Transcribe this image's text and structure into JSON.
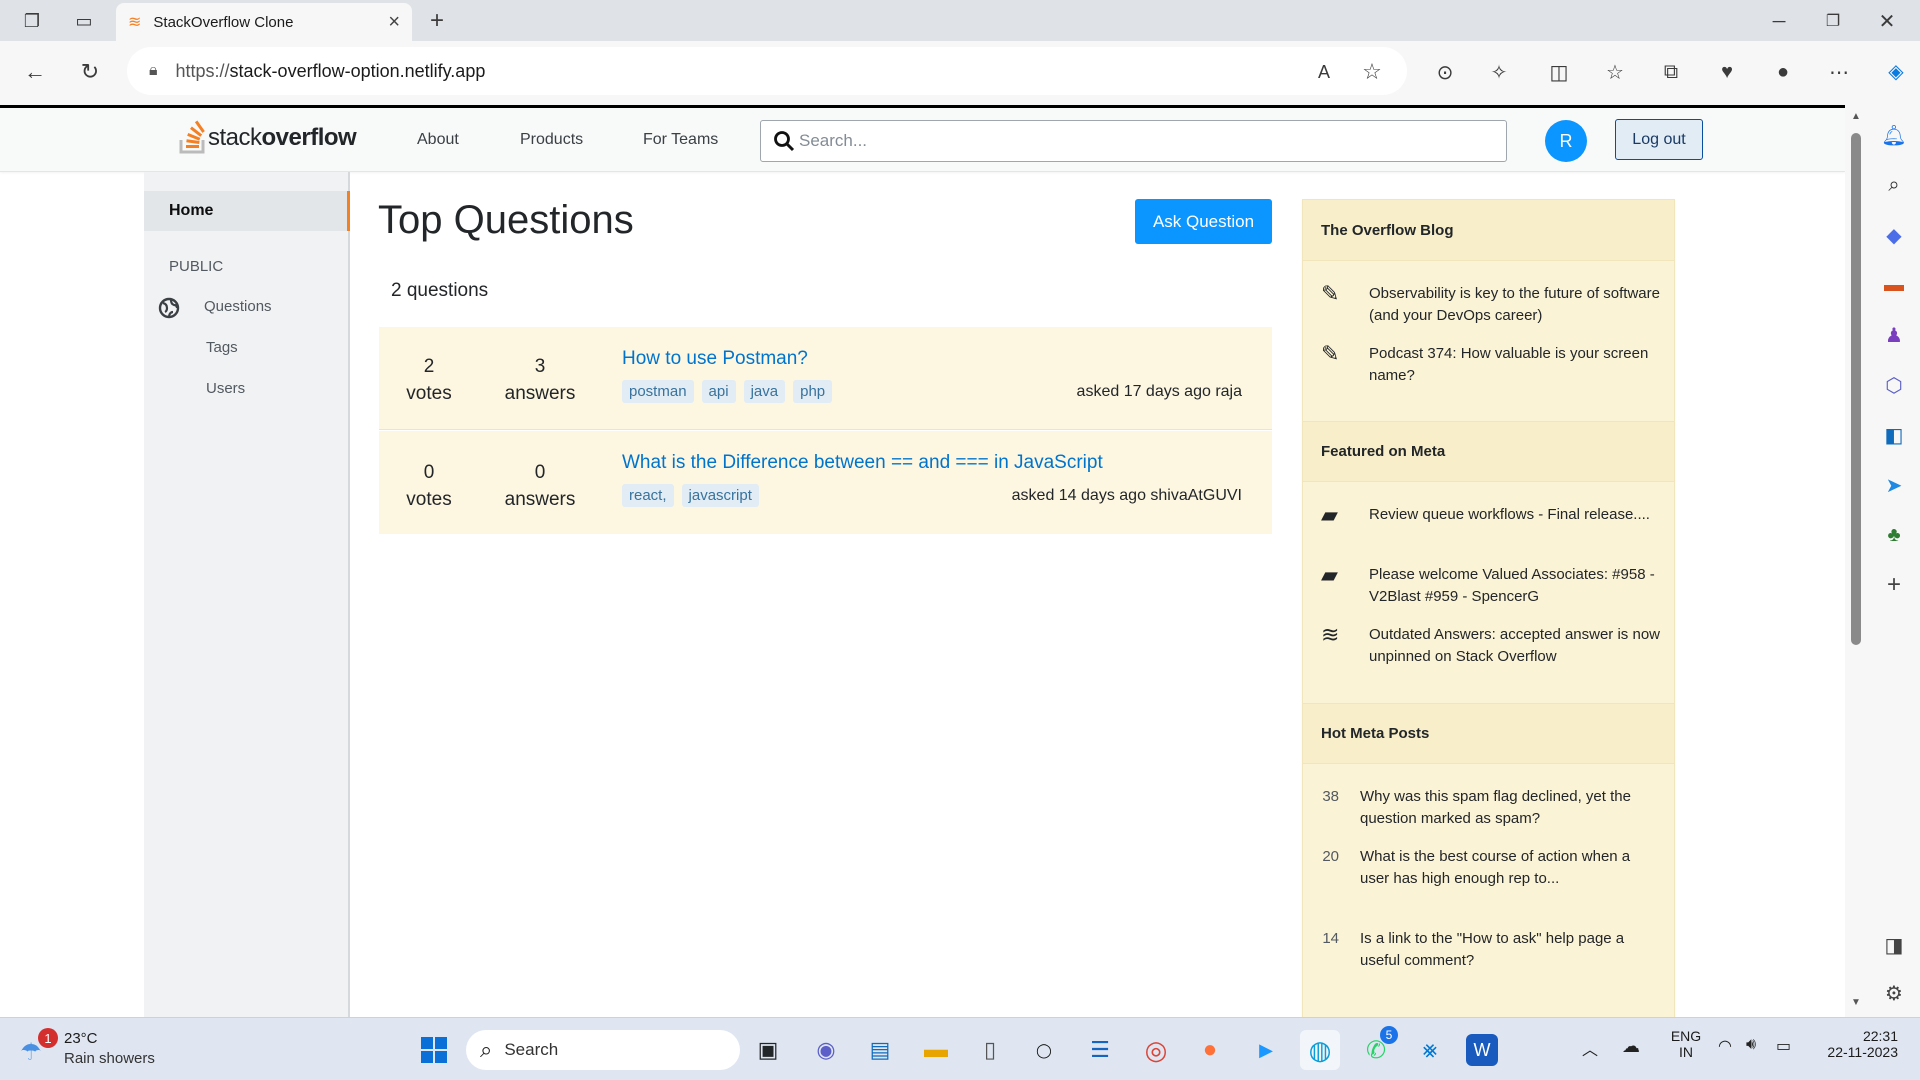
{
  "browser": {
    "tab_title": "StackOverflow Clone",
    "url_prefix": "https://",
    "url_host": "stack-overflow-option.netlify.app"
  },
  "header": {
    "logo_light": "stack",
    "logo_bold": "overflow",
    "nav": [
      "About",
      "Products",
      "For Teams"
    ],
    "search_placeholder": "Search...",
    "avatar_letter": "R",
    "logout_label": "Log out"
  },
  "sidebar": {
    "home": "Home",
    "section": "PUBLIC",
    "items": [
      "Questions",
      "Tags",
      "Users"
    ]
  },
  "main": {
    "title": "Top Questions",
    "ask_button": "Ask Question",
    "count_text": "2 questions",
    "questions": [
      {
        "votes": "2",
        "votes_label": "votes",
        "answers": "3",
        "answers_label": "answers",
        "title": "How to use Postman?",
        "tags": [
          "postman",
          "api",
          "java",
          "php"
        ],
        "asked": "asked 17 days ago raja"
      },
      {
        "votes": "0",
        "votes_label": "votes",
        "answers": "0",
        "answers_label": "answers",
        "title": "What is the Difference between == and === in JavaScript",
        "tags": [
          "react,",
          "javascript"
        ],
        "asked": "asked 14 days ago shivaAtGUVI"
      }
    ]
  },
  "widget": {
    "blog_title": "The Overflow Blog",
    "blog": [
      {
        "icon": "pencil-icon",
        "text": "Observability is key to the future of software (and your DevOps career)"
      },
      {
        "icon": "pencil-icon",
        "text": "Podcast 374: How valuable is your screen name?"
      }
    ],
    "meta_title": "Featured on Meta",
    "meta": [
      {
        "icon": "comment-icon",
        "text": "Review queue workflows - Final release...."
      },
      {
        "icon": "comment-icon",
        "text": "Please welcome Valued Associates: #958 - V2Blast #959 - SpencerG"
      },
      {
        "icon": "stackoverflow-icon",
        "text": "Outdated Answers: accepted answer is now unpinned on Stack Overflow"
      }
    ],
    "hot_title": "Hot Meta Posts",
    "hot": [
      {
        "num": "38",
        "text": "Why was this spam flag declined, yet the question marked as spam?"
      },
      {
        "num": "20",
        "text": "What is the best course of action when a user has high enough rep to..."
      },
      {
        "num": "14",
        "text": "Is a link to the \"How to ask\" help page a useful comment?"
      }
    ]
  },
  "taskbar": {
    "weather_temp": "23°C",
    "weather_desc": "Rain showers",
    "weather_badge": "1",
    "search_label": "Search",
    "whatsapp_badge": "5",
    "lang_1": "ENG",
    "lang_2": "IN",
    "time": "22:31",
    "date": "22-11-2023"
  },
  "colors": {
    "accent": "#f48024",
    "link": "#0074cc",
    "button": "#0a95ff",
    "widget_bg": "#fbf3d5"
  }
}
